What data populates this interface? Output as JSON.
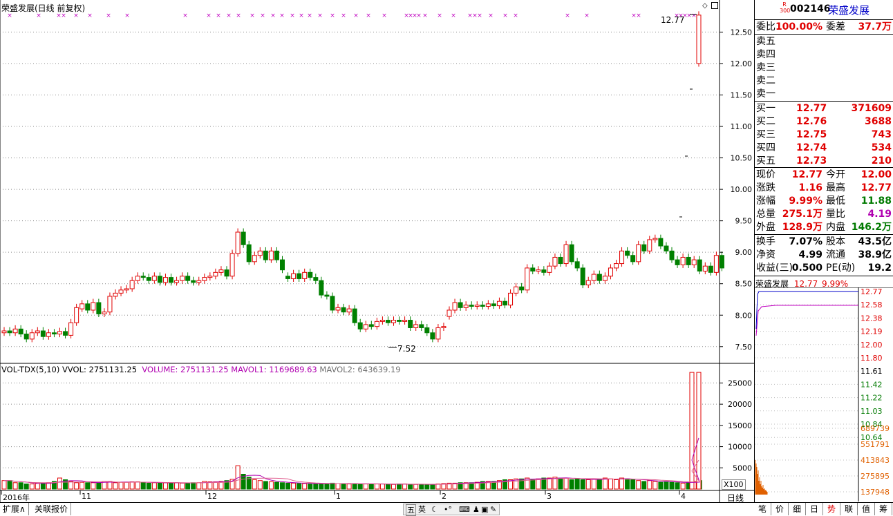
{
  "chart_title": "荣盛发展(日线 前复权)",
  "price_labels": {
    "high_marker": "12.77",
    "low_marker": "7.52"
  },
  "y_ticks_price": [
    "12.50",
    "12.00",
    "11.50",
    "11.00",
    "10.50",
    "10.00",
    "9.50",
    "9.00",
    "8.50",
    "8.00",
    "7.50"
  ],
  "vol_header": {
    "name": "VOL-TDX(5,10)",
    "vvol": "VVOL: 2751131.25",
    "volume": "VOLUME: 2751131.25",
    "mavol1": "MAVOL1: 1169689.63",
    "mavol2": "MAVOL2: 643639.19"
  },
  "y_ticks_vol": [
    "25000",
    "20000",
    "15000",
    "10000",
    "5000"
  ],
  "vol_unit": "X100",
  "x_labels": [
    "2016年",
    "11",
    "12",
    "1",
    "2",
    "3",
    "4"
  ],
  "period_label": "日线",
  "bottom_tabs": [
    "扩展∧",
    "关联报价"
  ],
  "right_tabs": [
    "笔",
    "价",
    "细",
    "日",
    "势",
    "联",
    "值",
    "筹"
  ],
  "tray_icons": [
    "五",
    "英"
  ],
  "colors": {
    "up": "#e00000",
    "down": "#008000",
    "ma1": "#b000b0",
    "ma2": "#e06090",
    "axis": "#000"
  },
  "quote": {
    "badge_top": "R",
    "badge_bottom": "300",
    "code": "002146",
    "name": "荣盛发展",
    "weibi_label": "委比",
    "weibi": "100.00%",
    "weicha_label": "委差",
    "weicha": "37.7万",
    "sells": [
      "卖五",
      "卖四",
      "卖三",
      "卖二",
      "卖一"
    ],
    "buys": [
      {
        "label": "买一",
        "price": "12.77",
        "vol": "371609"
      },
      {
        "label": "买二",
        "price": "12.76",
        "vol": "3688"
      },
      {
        "label": "买三",
        "price": "12.75",
        "vol": "743"
      },
      {
        "label": "买四",
        "price": "12.74",
        "vol": "534"
      },
      {
        "label": "买五",
        "price": "12.73",
        "vol": "210"
      }
    ],
    "stats": [
      {
        "l1": "现价",
        "v1": "12.77",
        "l2": "今开",
        "v2": "12.00"
      },
      {
        "l1": "涨跌",
        "v1": "1.16",
        "l2": "最高",
        "v2": "12.77"
      },
      {
        "l1": "涨幅",
        "v1": "9.99%",
        "l2": "最低",
        "v2": "11.88"
      },
      {
        "l1": "总量",
        "v1": "275.1万",
        "l2": "量比",
        "v2": "4.19"
      },
      {
        "l1": "外盘",
        "v1": "128.9万",
        "l2": "内盘",
        "v2": "146.2万"
      }
    ],
    "fund": [
      {
        "l1": "换手",
        "v1": "7.07%",
        "l2": "股本",
        "v2": "43.5亿"
      },
      {
        "l1": "净资",
        "v1": "4.99",
        "l2": "流通",
        "v2": "38.9亿"
      },
      {
        "l1": "收益(三)",
        "v1": "0.500",
        "l2": "PE(动)",
        "v2": "19.2"
      }
    ],
    "mini_title": "荣盛发展",
    "mini_price": "12.77",
    "mini_pct": "9.99%",
    "mini_ticks": [
      "12.77",
      "12.58",
      "12.38",
      "12.19",
      "12.00",
      "11.80",
      "11.61",
      "11.42",
      "11.22",
      "11.03",
      "10.84",
      "10.64"
    ],
    "mini_vol_ticks": [
      "689739",
      "551791",
      "413843",
      "275895",
      "137948"
    ]
  },
  "chart_data": {
    "type": "candlestick",
    "title": "荣盛发展(日线 前复权)",
    "ylim": [
      7.3,
      12.9
    ],
    "candles": [
      {
        "o": 7.72,
        "c": 7.75
      },
      {
        "o": 7.75,
        "c": 7.72
      },
      {
        "o": 7.72,
        "c": 7.78
      },
      {
        "o": 7.78,
        "c": 7.7
      },
      {
        "o": 7.7,
        "c": 7.62
      },
      {
        "o": 7.62,
        "c": 7.72
      },
      {
        "o": 7.72,
        "c": 7.75
      },
      {
        "o": 7.75,
        "c": 7.66
      },
      {
        "o": 7.66,
        "c": 7.72
      },
      {
        "o": 7.72,
        "c": 7.7
      },
      {
        "o": 7.7,
        "c": 7.74
      },
      {
        "o": 7.74,
        "c": 7.68
      },
      {
        "o": 7.68,
        "c": 7.88
      },
      {
        "o": 7.88,
        "c": 8.12
      },
      {
        "o": 8.1,
        "c": 8.18
      },
      {
        "o": 8.18,
        "c": 8.08
      },
      {
        "o": 8.08,
        "c": 8.2
      },
      {
        "o": 8.2,
        "c": 8.02
      },
      {
        "o": 8.02,
        "c": 8.05
      },
      {
        "o": 8.05,
        "c": 8.3
      },
      {
        "o": 8.3,
        "c": 8.35
      },
      {
        "o": 8.35,
        "c": 8.4
      },
      {
        "o": 8.4,
        "c": 8.42
      },
      {
        "o": 8.42,
        "c": 8.55
      },
      {
        "o": 8.55,
        "c": 8.62
      },
      {
        "o": 8.62,
        "c": 8.6
      },
      {
        "o": 8.6,
        "c": 8.55
      },
      {
        "o": 8.55,
        "c": 8.62
      },
      {
        "o": 8.62,
        "c": 8.52
      },
      {
        "o": 8.52,
        "c": 8.6
      },
      {
        "o": 8.6,
        "c": 8.52
      },
      {
        "o": 8.52,
        "c": 8.55
      },
      {
        "o": 8.55,
        "c": 8.62
      },
      {
        "o": 8.62,
        "c": 8.55
      },
      {
        "o": 8.55,
        "c": 8.52
      },
      {
        "o": 8.52,
        "c": 8.55
      },
      {
        "o": 8.55,
        "c": 8.6
      },
      {
        "o": 8.6,
        "c": 8.62
      },
      {
        "o": 8.62,
        "c": 8.68
      },
      {
        "o": 8.68,
        "c": 8.72
      },
      {
        "o": 8.72,
        "c": 8.62
      },
      {
        "o": 8.62,
        "c": 8.98
      },
      {
        "o": 8.98,
        "c": 9.32
      },
      {
        "o": 9.32,
        "c": 9.12
      },
      {
        "o": 9.12,
        "c": 8.85
      },
      {
        "o": 8.85,
        "c": 8.95
      },
      {
        "o": 8.95,
        "c": 9.02
      },
      {
        "o": 9.02,
        "c": 8.88
      },
      {
        "o": 8.88,
        "c": 9.02
      },
      {
        "o": 9.02,
        "c": 8.88
      },
      {
        "o": 8.88,
        "c": 8.72
      },
      {
        "o": 8.62,
        "c": 8.58
      },
      {
        "o": 8.58,
        "c": 8.66
      },
      {
        "o": 8.66,
        "c": 8.58
      },
      {
        "o": 8.58,
        "c": 8.68
      },
      {
        "o": 8.68,
        "c": 8.6
      },
      {
        "o": 8.6,
        "c": 8.55
      },
      {
        "o": 8.55,
        "c": 8.32
      },
      {
        "o": 8.32,
        "c": 8.3
      },
      {
        "o": 8.3,
        "c": 8.08
      },
      {
        "o": 8.08,
        "c": 8.12
      },
      {
        "o": 8.12,
        "c": 8.05
      },
      {
        "o": 8.05,
        "c": 8.1
      },
      {
        "o": 8.1,
        "c": 7.88
      },
      {
        "o": 7.88,
        "c": 7.78
      },
      {
        "o": 7.78,
        "c": 7.85
      },
      {
        "o": 7.85,
        "c": 7.82
      },
      {
        "o": 7.82,
        "c": 7.9
      },
      {
        "o": 7.9,
        "c": 7.92
      },
      {
        "o": 7.92,
        "c": 7.88
      },
      {
        "o": 7.88,
        "c": 7.92
      },
      {
        "o": 7.92,
        "c": 7.9
      },
      {
        "o": 7.9,
        "c": 7.92
      },
      {
        "o": 7.92,
        "c": 7.8
      },
      {
        "o": 7.8,
        "c": 7.85
      },
      {
        "o": 7.85,
        "c": 7.8
      },
      {
        "o": 7.8,
        "c": 7.72
      },
      {
        "o": 7.72,
        "c": 7.62
      },
      {
        "o": 7.62,
        "c": 7.8
      },
      {
        "o": 7.8,
        "c": 7.82
      },
      {
        "o": 7.98,
        "c": 8.08
      },
      {
        "o": 8.08,
        "c": 8.2
      },
      {
        "o": 8.2,
        "c": 8.12
      },
      {
        "o": 8.12,
        "c": 8.16
      },
      {
        "o": 8.16,
        "c": 8.14
      },
      {
        "o": 8.14,
        "c": 8.16
      },
      {
        "o": 8.16,
        "c": 8.14
      },
      {
        "o": 8.14,
        "c": 8.18
      },
      {
        "o": 8.18,
        "c": 8.15
      },
      {
        "o": 8.15,
        "c": 8.22
      },
      {
        "o": 8.22,
        "c": 8.16
      },
      {
        "o": 8.16,
        "c": 8.35
      },
      {
        "o": 8.35,
        "c": 8.45
      },
      {
        "o": 8.45,
        "c": 8.4
      },
      {
        "o": 8.4,
        "c": 8.75
      },
      {
        "o": 8.75,
        "c": 8.7
      },
      {
        "o": 8.7,
        "c": 8.72
      },
      {
        "o": 8.72,
        "c": 8.68
      },
      {
        "o": 8.68,
        "c": 8.78
      },
      {
        "o": 8.78,
        "c": 8.92
      },
      {
        "o": 8.92,
        "c": 8.82
      },
      {
        "o": 8.82,
        "c": 9.12
      },
      {
        "o": 9.12,
        "c": 8.85
      },
      {
        "o": 8.85,
        "c": 8.75
      },
      {
        "o": 8.75,
        "c": 8.48
      },
      {
        "o": 8.48,
        "c": 8.55
      },
      {
        "o": 8.55,
        "c": 8.65
      },
      {
        "o": 8.65,
        "c": 8.55
      },
      {
        "o": 8.55,
        "c": 8.62
      },
      {
        "o": 8.62,
        "c": 8.75
      },
      {
        "o": 8.75,
        "c": 8.82
      },
      {
        "o": 8.82,
        "c": 9.02
      },
      {
        "o": 9.02,
        "c": 8.95
      },
      {
        "o": 8.95,
        "c": 8.85
      },
      {
        "o": 8.85,
        "c": 9.12
      },
      {
        "o": 9.12,
        "c": 9.02
      },
      {
        "o": 9.02,
        "c": 9.2
      },
      {
        "o": 9.2,
        "c": 9.22
      },
      {
        "o": 9.22,
        "c": 9.1
      },
      {
        "o": 9.1,
        "c": 9.02
      },
      {
        "o": 9.02,
        "c": 8.88
      },
      {
        "o": 8.88,
        "c": 8.8
      },
      {
        "o": 8.8,
        "c": 8.92
      },
      {
        "o": 8.92,
        "c": 8.8
      },
      {
        "o": 8.8,
        "c": 8.88
      },
      {
        "o": 8.88,
        "c": 8.7
      },
      {
        "o": 8.7,
        "c": 8.78
      },
      {
        "o": 8.78,
        "c": 8.68
      },
      {
        "o": 8.68,
        "c": 8.95
      },
      {
        "o": 8.95,
        "c": 8.75
      },
      {
        "o": 12.0,
        "c": 12.77
      }
    ],
    "volumes": [
      2,
      2,
      1.5,
      1.5,
      1.2,
      1.2,
      1.3,
      1.4,
      1.5,
      1.8,
      2.6,
      2.2,
      1.8,
      1.5,
      1.6,
      1.5,
      1.5,
      1.5,
      1.8,
      1.8,
      1.5,
      1.6,
      1.6,
      1.7,
      1.7,
      1.5,
      1.4,
      1.5,
      1.5,
      1.5,
      1.4,
      1.5,
      1.4,
      1.4,
      1.5,
      1.5,
      1.8,
      1.7,
      1.7,
      1.8,
      2,
      2.3,
      5.5,
      3.5,
      2.8,
      2.2,
      2,
      1.8,
      1.7,
      1.6,
      1.5,
      1.4,
      1.4,
      1.3,
      1.3,
      1.2,
      1.2,
      1.3,
      1.3,
      1.4,
      1.3,
      1.2,
      1.2,
      1.3,
      1.2,
      1.2,
      1.2,
      1.2,
      1.2,
      1.1,
      1.1,
      1.2,
      1.2,
      1.1,
      1.1,
      1.1,
      1.1,
      1.1,
      1.2,
      1.3,
      1.4,
      1.4,
      1.5,
      1.5,
      1.5,
      1.6,
      1.8,
      1.8,
      1.8,
      2,
      2.2,
      2.2,
      2.4,
      2.4,
      2.6,
      2.2,
      2.4,
      2.6,
      2.6,
      2.8,
      2.6,
      2.6,
      2.2,
      2.4,
      2.2,
      2.2,
      2.4,
      2.2,
      2.6,
      2.4,
      2.2,
      2.6,
      2.4,
      2.2,
      2,
      1.8,
      2,
      1.8,
      1.6,
      1.8,
      1.6,
      1.5,
      1.4,
      1.5,
      1.8,
      2,
      27.5,
      27.5
    ]
  }
}
